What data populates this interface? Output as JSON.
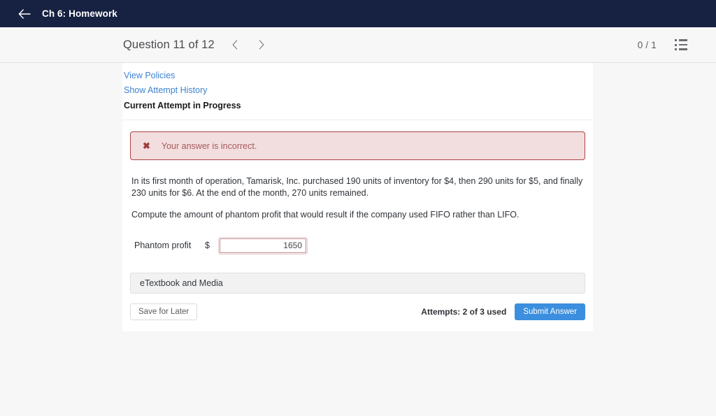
{
  "appbar": {
    "back_icon": "arrow-left-icon",
    "title": "Ch 6: Homework"
  },
  "question_bar": {
    "title": "Question 11 of 12",
    "prev_icon": "chevron-left-icon",
    "next_icon": "chevron-right-icon",
    "score": "0 / 1",
    "list_icon": "ordered-list-icon"
  },
  "card": {
    "links": [
      {
        "label": "View Policies"
      },
      {
        "label": "Show Attempt History"
      }
    ],
    "attempt_heading": "Current Attempt in Progress",
    "alert": {
      "icon": "✖",
      "icon_name": "error-x-icon",
      "message": "Your answer is incorrect.",
      "background": "#f2dede",
      "border_color": "#a94442",
      "text_color": "#a8595c"
    },
    "question": {
      "paragraph_1": "In its first month of operation, Tamarisk, Inc. purchased 190 units of inventory for $4, then 290 units for $5, and finally 230 units for $6. At the end of the month, 270 units remained.",
      "paragraph_2": "Compute the amount of phantom profit that would result if the company used FIFO rather than LIFO."
    },
    "answer": {
      "label": "Phantom profit",
      "currency": "$",
      "value": "1650",
      "placeholder": ""
    },
    "etextbook_label": "eTextbook and Media",
    "footer": {
      "save_label": "Save for Later",
      "attempts_text": "Attempts: 2 of 3 used",
      "submit_label": "Submit Answer",
      "submit_color": "#3b8fde"
    }
  }
}
